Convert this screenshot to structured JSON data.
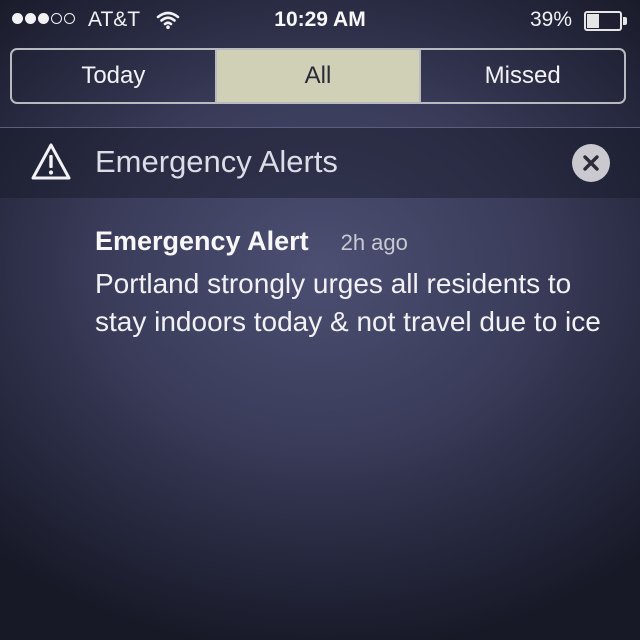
{
  "status_bar": {
    "signal_bars_filled": 3,
    "signal_bars_total": 5,
    "carrier": "AT&T",
    "wifi_icon": "wifi-icon",
    "time": "10:29 AM",
    "battery_percent_label": "39%",
    "battery_level": 0.39
  },
  "segmented_control": {
    "tabs": [
      {
        "label": "Today",
        "selected": false
      },
      {
        "label": "All",
        "selected": true
      },
      {
        "label": "Missed",
        "selected": false
      }
    ]
  },
  "section": {
    "icon": "warning-triangle-icon",
    "title": "Emergency Alerts",
    "close_icon": "close-icon"
  },
  "notification": {
    "title": "Emergency Alert",
    "time_ago": "2h ago",
    "body": "Portland strongly urges all residents to stay indoors today & not travel due to ice"
  },
  "colors": {
    "selected_tab_bg": "#cfd0b5",
    "background": "#3a3c5a"
  }
}
